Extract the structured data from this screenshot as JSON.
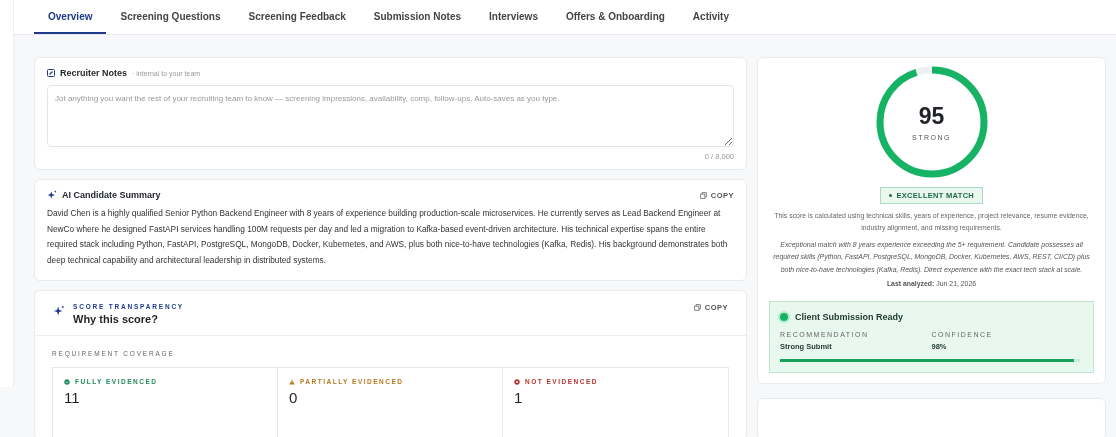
{
  "tabs": [
    {
      "label": "Overview",
      "selected": true
    },
    {
      "label": "Screening Questions",
      "selected": false
    },
    {
      "label": "Screening Feedback",
      "selected": false
    },
    {
      "label": "Submission Notes",
      "selected": false
    },
    {
      "label": "Interviews",
      "selected": false
    },
    {
      "label": "Offers & Onboarding",
      "selected": false
    },
    {
      "label": "Activity",
      "selected": false
    }
  ],
  "recruiter_notes": {
    "title": "Recruiter Notes",
    "subtitle": "· internal to your team",
    "placeholder": "Jot anything you want the rest of your recruiting team to know — screening impressions, availability, comp, follow-ups. Auto-saves as you type.",
    "counter": "0 / 8,000"
  },
  "ai_summary": {
    "title": "AI Candidate Summary",
    "copy": "COPY",
    "text": "David Chen is a highly qualified Senior Python Backend Engineer with 8 years of experience building production-scale microservices. He currently serves as Lead Backend Engineer at NewCo where he designed FastAPI services handling 100M requests per day and led a migration to Kafka-based event-driven architecture. His technical expertise spans the entire required stack including Python, FastAPI, PostgreSQL, MongoDB, Docker, Kubernetes, and AWS, plus both nice-to-have technologies (Kafka, Redis). His background demonstrates both deep technical capability and architectural leadership in distributed systems."
  },
  "score_transparency": {
    "eyebrow": "SCORE TRANSPARENCY",
    "title": "Why this score?",
    "copy": "COPY",
    "coverage_label": "REQUIREMENT COVERAGE",
    "coverage": [
      {
        "kind": "full",
        "label": "FULLY EVIDENCED",
        "count": "11",
        "color": "#1f8a5b"
      },
      {
        "kind": "partial",
        "label": "PARTIALLY EVIDENCED",
        "count": "0",
        "color": "#b7791f"
      },
      {
        "kind": "none",
        "label": "NOT EVIDENCED",
        "count": "1",
        "color": "#b83232"
      }
    ]
  },
  "score": {
    "value": "95",
    "rating": "STRONG",
    "level": 0.95,
    "badge": "EXCELLENT MATCH",
    "explanation": "This score is calculated using technical skills, years of experience, project relevance, resume evidence, industry alignment, and missing requirements.",
    "assessment": "Exceptional match with 8 years experience exceeding the 5+ requirement. Candidate possesses all required skills (Python, FastAPI, PostgreSQL, MongoDB, Docker, Kubernetes, AWS, REST, CI/CD) plus both nice-to-have technologies (Kafka, Redis). Direct experience with the exact tech stack at scale.",
    "last_analyzed": "**Last analyzed:** Jun 21, 2026"
  },
  "submission": {
    "title": "Client Submission Ready",
    "recommendation_label": "RECOMMENDATION",
    "recommendation": "Strong Submit",
    "confidence_label": "CONFIDENCE",
    "confidence": "98%",
    "level": 0.98
  }
}
